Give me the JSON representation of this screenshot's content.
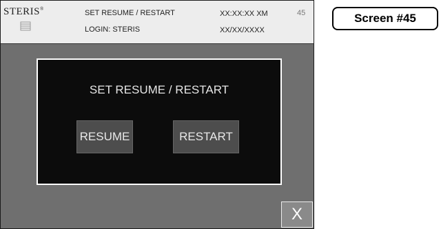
{
  "header": {
    "logo_text": "STERIS",
    "logo_mark": "®",
    "screen_title": "SET RESUME / RESTART",
    "login": "LOGIN: STERIS",
    "time": "XX:XX:XX XM",
    "date": "XX/XX/XXXX",
    "screen_number": "45"
  },
  "dialog": {
    "title": "SET RESUME / RESTART",
    "resume_label": "RESUME",
    "restart_label": "RESTART"
  },
  "close_label": "X",
  "callout": "Screen #45",
  "colors": {
    "panel_bg": "#6f6f6f",
    "dialog_bg": "#0c0c0c",
    "button_bg": "#4d4d4d"
  }
}
